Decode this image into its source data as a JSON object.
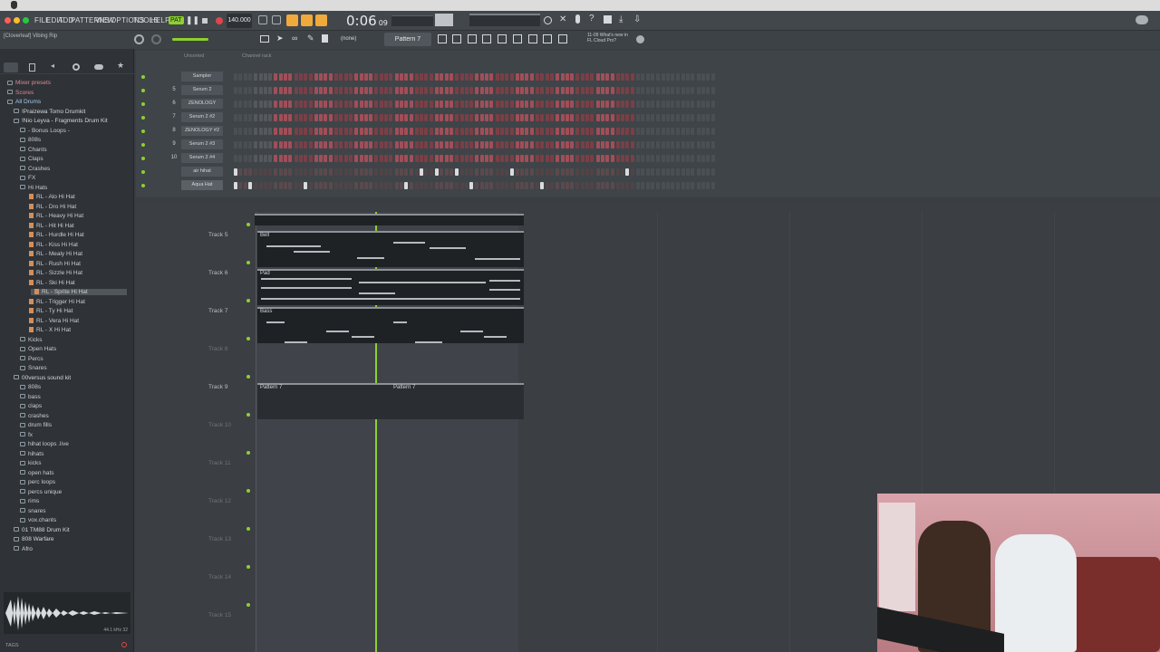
{
  "menu": [
    "FILE",
    "EDIT",
    "ADD",
    "PATTERNS",
    "VIEW",
    "OPTIONS",
    "TOOLS",
    "HELP"
  ],
  "transport": {
    "pat_label": "PAT",
    "tempo": "140.000",
    "time": "0:06",
    "time_small": "09"
  },
  "toolbar": {
    "project": "[Cloverleaf] Vibing Rip",
    "none_label": "(none)",
    "pattern": "Pattern 7",
    "news": "11-09 What's new in FL Cloud Pro?"
  },
  "rack_header": {
    "filter": "Unsorted",
    "label": "Channel rack"
  },
  "browser": {
    "items": [
      {
        "t": "Mixer presets",
        "k": "top"
      },
      {
        "t": "Scores",
        "k": "top"
      },
      {
        "t": "All Drums",
        "k": "root"
      },
      {
        "t": "!Praizewa Tomo Drumkit",
        "k": "f1"
      },
      {
        "t": "!Nio Leyva - Fragments Drum Kit",
        "k": "f1"
      },
      {
        "t": "- Bonus Loops -",
        "k": "f2"
      },
      {
        "t": "808s",
        "k": "f2"
      },
      {
        "t": "Chants",
        "k": "f2"
      },
      {
        "t": "Claps",
        "k": "f2"
      },
      {
        "t": "Crashes",
        "k": "f2"
      },
      {
        "t": "FX",
        "k": "f2"
      },
      {
        "t": "Hi Hats",
        "k": "f2"
      },
      {
        "t": "RL - Alo Hi Hat",
        "k": "file"
      },
      {
        "t": "RL - Dro Hi Hat",
        "k": "file"
      },
      {
        "t": "RL - Heavy Hi Hat",
        "k": "file"
      },
      {
        "t": "RL - Hit Hi Hat",
        "k": "file"
      },
      {
        "t": "RL - Hurdle Hi Hat",
        "k": "file"
      },
      {
        "t": "RL - Kiss Hi Hat",
        "k": "file"
      },
      {
        "t": "RL - Mealy Hi Hat",
        "k": "file"
      },
      {
        "t": "RL - Rush Hi Hat",
        "k": "file"
      },
      {
        "t": "RL - Sizzle Hi Hat",
        "k": "file"
      },
      {
        "t": "RL - Ski Hi Hat",
        "k": "file"
      },
      {
        "t": "RL - Sprite Hi Hat",
        "k": "sel"
      },
      {
        "t": "RL - Trigger Hi Hat",
        "k": "file"
      },
      {
        "t": "RL - Ty Hi Hat",
        "k": "file"
      },
      {
        "t": "RL - Vera Hi Hat",
        "k": "file"
      },
      {
        "t": "RL - X Hi Hat",
        "k": "file"
      },
      {
        "t": "Kicks",
        "k": "f2"
      },
      {
        "t": "Open Hats",
        "k": "f2"
      },
      {
        "t": "Percs",
        "k": "f2"
      },
      {
        "t": "Snares",
        "k": "f2"
      },
      {
        "t": "00versus sound kit",
        "k": "f1"
      },
      {
        "t": "808s",
        "k": "f2"
      },
      {
        "t": "bass",
        "k": "f2"
      },
      {
        "t": "claps",
        "k": "f2"
      },
      {
        "t": "crashes",
        "k": "f2"
      },
      {
        "t": "drum fills",
        "k": "f2"
      },
      {
        "t": "fx",
        "k": "f2"
      },
      {
        "t": "hihat loops .live",
        "k": "f2"
      },
      {
        "t": "hihats",
        "k": "f2"
      },
      {
        "t": "kicks",
        "k": "f2"
      },
      {
        "t": "open hats",
        "k": "f2"
      },
      {
        "t": "perc loops",
        "k": "f2"
      },
      {
        "t": "percs unique",
        "k": "f2"
      },
      {
        "t": "rims",
        "k": "f2"
      },
      {
        "t": "snares",
        "k": "f2"
      },
      {
        "t": "vox.chants",
        "k": "f2"
      },
      {
        "t": "01 TM88 Drum Kit",
        "k": "f1"
      },
      {
        "t": "808 Warfare",
        "k": "f1"
      },
      {
        "t": "Afro",
        "k": "f1"
      }
    ],
    "waveform_info": "44.1 kHz 32",
    "tags_label": "TAGS"
  },
  "channels": [
    {
      "num": "",
      "name": "Sampler",
      "steps": []
    },
    {
      "num": "5",
      "name": "Serum 2",
      "steps": []
    },
    {
      "num": "6",
      "name": "ZENOLOGY",
      "steps": []
    },
    {
      "num": "7",
      "name": "Serum 2 #2",
      "steps": []
    },
    {
      "num": "8",
      "name": "ZENOLOGY #2",
      "steps": []
    },
    {
      "num": "9",
      "name": "Serum 2 #3",
      "steps": []
    },
    {
      "num": "10",
      "name": "Serum 2 #4",
      "steps": []
    },
    {
      "num": "",
      "name": "air hihat",
      "steps": [
        1,
        0,
        0,
        0,
        0,
        0,
        0,
        0,
        0,
        0,
        0,
        0,
        0,
        0,
        0,
        0,
        0,
        0,
        0,
        0,
        0,
        0,
        0,
        0,
        0,
        0,
        0,
        0,
        0,
        0,
        0,
        0,
        0,
        0,
        0,
        0,
        0,
        1,
        0,
        0,
        1,
        0,
        0,
        0,
        1,
        0,
        0,
        0,
        0,
        0,
        0,
        0,
        0,
        0,
        0,
        1,
        0,
        0,
        0,
        0,
        0,
        0,
        0,
        0,
        0,
        0,
        0,
        0,
        0,
        0,
        0,
        0,
        0,
        0,
        0,
        0,
        0,
        0,
        1,
        0,
        0,
        0,
        0,
        0,
        0,
        0,
        0,
        0,
        0,
        1,
        0,
        0,
        0,
        1,
        0,
        0
      ]
    },
    {
      "num": "",
      "name": "Aqua Hat",
      "steps": [
        1,
        0,
        0,
        1,
        0,
        0,
        0,
        0,
        0,
        0,
        0,
        0,
        0,
        0,
        1,
        0,
        0,
        0,
        0,
        0,
        0,
        0,
        0,
        0,
        0,
        0,
        0,
        0,
        0,
        0,
        0,
        0,
        0,
        0,
        1,
        0,
        0,
        0,
        0,
        0,
        0,
        0,
        0,
        0,
        0,
        0,
        0,
        1,
        0,
        0,
        0,
        0,
        0,
        0,
        0,
        0,
        0,
        0,
        0,
        0,
        0,
        1,
        0,
        0,
        0,
        0,
        0,
        0,
        0,
        0,
        0,
        0,
        0,
        0,
        0,
        0,
        0,
        0,
        0,
        0,
        0,
        0,
        0,
        0,
        0,
        0,
        0,
        0,
        1,
        0,
        0,
        0,
        0,
        0,
        0,
        0
      ]
    }
  ],
  "tracks": [
    {
      "label": "Track 5",
      "dim": false
    },
    {
      "label": "Track 6",
      "dim": false
    },
    {
      "label": "Track 7",
      "dim": false
    },
    {
      "label": "Track 8",
      "dim": true
    },
    {
      "label": "Track 9",
      "dim": false
    },
    {
      "label": "Track 10",
      "dim": true
    },
    {
      "label": "Track 11",
      "dim": true
    },
    {
      "label": "Track 12",
      "dim": true
    },
    {
      "label": "Track 13",
      "dim": true
    },
    {
      "label": "Track 14",
      "dim": true
    },
    {
      "label": "Track 15",
      "dim": true
    }
  ],
  "clips": {
    "bell": "Bell",
    "pad": "Pad",
    "bass": "Bass",
    "pattern_a": "Pattern 7",
    "pattern_b": "Pattern 7"
  },
  "colors": {
    "accent": "#8cd12f",
    "step_on": "#ff6f76",
    "step_off": "#5b4245",
    "step_dim": "#4a4f54"
  }
}
